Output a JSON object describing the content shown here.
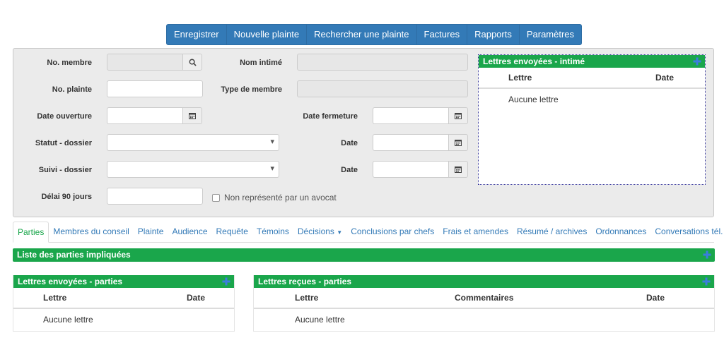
{
  "nav": {
    "save": "Enregistrer",
    "new_complaint": "Nouvelle plainte",
    "search_complaint": "Rechercher une plainte",
    "invoices": "Factures",
    "reports": "Rapports",
    "settings": "Paramètres"
  },
  "form": {
    "member_no_label": "No. membre",
    "respondent_name_label": "Nom intimé",
    "complaint_no_label": "No. plainte",
    "member_type_label": "Type de membre",
    "open_date_label": "Date ouverture",
    "close_date_label": "Date fermeture",
    "file_status_label": "Statut - dossier",
    "status_date_label": "Date",
    "file_followup_label": "Suivi - dossier",
    "followup_date_label": "Date",
    "delay_label": "Délai 90 jours",
    "not_represented_label": "Non représenté par un avocat"
  },
  "letters_sent_respondent": {
    "title": "Lettres envoyées - intimé",
    "col_letter": "Lettre",
    "col_date": "Date",
    "empty": "Aucune lettre"
  },
  "tabs": [
    {
      "label": "Parties"
    },
    {
      "label": "Membres du conseil"
    },
    {
      "label": "Plainte"
    },
    {
      "label": "Audience"
    },
    {
      "label": "Requête"
    },
    {
      "label": "Témoins"
    },
    {
      "label": "Décisions"
    },
    {
      "label": "Conclusions par chefs"
    },
    {
      "label": "Frais et amendes"
    },
    {
      "label": "Résumé / archives"
    },
    {
      "label": "Ordonnances"
    },
    {
      "label": "Conversations tél."
    }
  ],
  "parties_list": {
    "title": "Liste des parties impliquées"
  },
  "letters_sent_parties": {
    "title": "Lettres envoyées - parties",
    "col_letter": "Lettre",
    "col_date": "Date",
    "empty": "Aucune lettre"
  },
  "letters_received_parties": {
    "title": "Lettres reçues - parties",
    "col_letter": "Lettre",
    "col_comments": "Commentaires",
    "col_date": "Date",
    "empty": "Aucune lettre"
  },
  "colors": {
    "nav_blue": "#337ab7",
    "panel_green": "#1aa64b",
    "link_blue": "#337ab7"
  }
}
